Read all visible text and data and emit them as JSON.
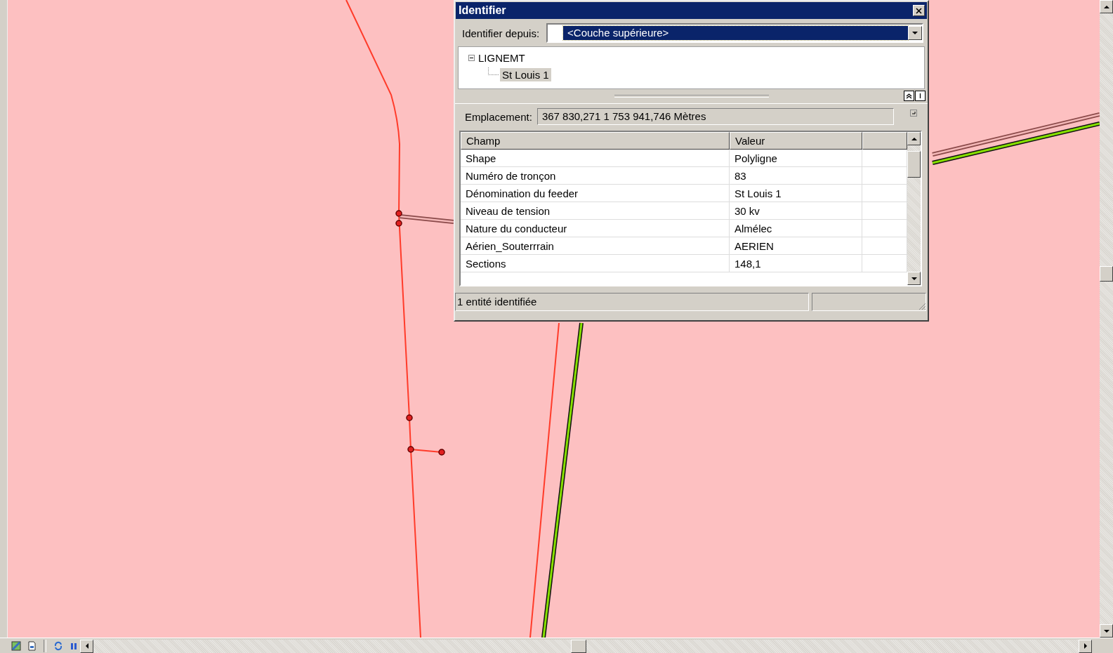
{
  "dialog": {
    "title": "Identifier",
    "identify_from": {
      "label": "Identifier depuis:",
      "value": "<Couche supérieure>"
    },
    "tree": [
      {
        "label": "LIGNEMT",
        "expanded": true,
        "selected": false,
        "children": [
          {
            "label": "St Louis 1",
            "selected": true
          }
        ]
      }
    ],
    "location": {
      "label": "Emplacement:",
      "value": "367 830,271  1 753 941,746 Mètres"
    },
    "table": {
      "columns": [
        "Champ",
        "Valeur"
      ],
      "rows": [
        [
          "Shape",
          "Polyligne"
        ],
        [
          "Numéro de tronçon",
          "83"
        ],
        [
          "Dénomination du feeder",
          "St Louis 1"
        ],
        [
          "Niveau de tension",
          "30 kv"
        ],
        [
          "Nature du conducteur",
          "Almélec"
        ],
        [
          "Aérien_Souterrrain",
          "AERIEN"
        ],
        [
          "Sections",
          "148,1"
        ]
      ]
    },
    "status_bar": [
      "1 entité identifiée"
    ]
  }
}
